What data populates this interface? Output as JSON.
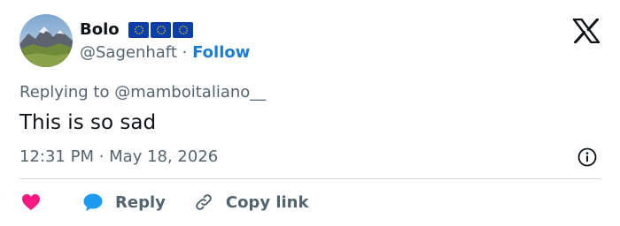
{
  "author": {
    "name": "Bolo",
    "handle": "@Sagenhaft",
    "separator": "·",
    "follow_label": "Follow",
    "flag_icons": [
      "eu-flag-icon",
      "eu-flag-icon",
      "eu-flag-icon"
    ]
  },
  "brand_icon": "x-logo-icon",
  "tweet": {
    "replying_to": "Replying to @mamboitaliano__",
    "text": "This is so sad",
    "timestamp": "12:31 PM · May 18, 2026"
  },
  "actions": {
    "like_icon": "heart-icon",
    "reply_label": "Reply",
    "copy_link_label": "Copy link"
  },
  "colors": {
    "follow": "#1d7bd8",
    "like": "#f91880",
    "reply_icon": "#1d9bf0",
    "muted": "#536471",
    "flag_blue": "#0b3ea8",
    "flag_star": "#ffd700"
  }
}
